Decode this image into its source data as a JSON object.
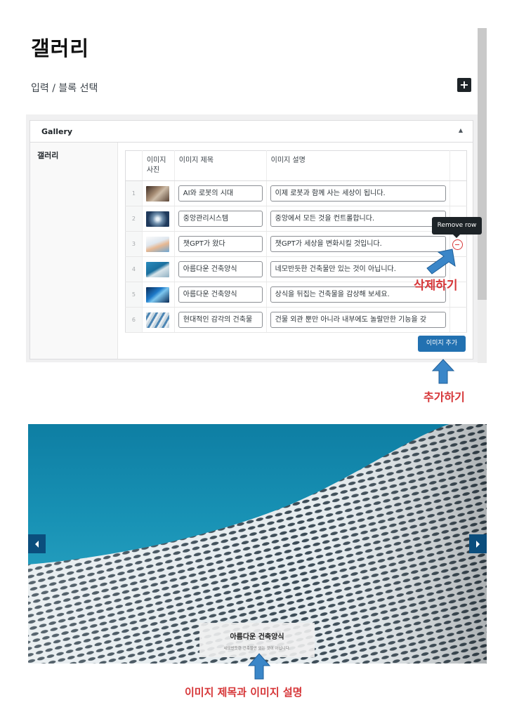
{
  "page": {
    "title": "갤러리",
    "subtitle": "입력 / 블록 선택",
    "add_block_icon": "+"
  },
  "panel": {
    "title": "Gallery",
    "toggle_icon": "▲",
    "field_label": "갤러리"
  },
  "table": {
    "headers": {
      "photo": "이미지 사진",
      "title": "이미지 제목",
      "description": "이미지 설명"
    },
    "rows": [
      {
        "index": "1",
        "thumb": "photo-robot-room",
        "title": "AI와 로봇의 시대",
        "description": "이제 로봇과 함께 사는 세상이 됩니다."
      },
      {
        "index": "2",
        "thumb": "photo-central-system",
        "title": "중앙관리시스템",
        "description": "중앙에서 모든 것을 컨트롤합니다."
      },
      {
        "index": "3",
        "thumb": "photo-chatgpt",
        "title": "챗GPT가 왔다",
        "description": "챗GPT가 세상을 변화시킬 것입니다."
      },
      {
        "index": "4",
        "thumb": "photo-architecture",
        "title": "아름다운 건축양식",
        "description": "네모반듯한 건축물만 있는 것이 아닙니다."
      },
      {
        "index": "5",
        "thumb": "photo-architecture-blue",
        "title": "아름다운 건축양식",
        "description": "상식을 뒤집는 건축물을 감상해 보세요."
      },
      {
        "index": "6",
        "thumb": "photo-modern-building",
        "title": "현대적인 감각의 건축물",
        "description": "건물 외관 뿐만 아니라 내부에도 놀랄만한 기능을 갖"
      }
    ],
    "remove_tooltip": "Remove row",
    "add_row_label": "이미지 추가"
  },
  "annotations": {
    "delete_label": "삭제하기",
    "add_label": "추가하기",
    "caption_label": "이미지 제목과 이미지 설명"
  },
  "slider": {
    "caption_title": "아름다운 건축양식",
    "caption_desc": "네모반듯한 건축물만 있는 것이 아닙니다.",
    "prev_icon": "chevron-left-icon",
    "next_icon": "chevron-right-icon"
  },
  "colors": {
    "accent": "#2271b1",
    "annotation": "#d63638",
    "arrow": "#3a86c8",
    "sky": "#1892b5"
  }
}
